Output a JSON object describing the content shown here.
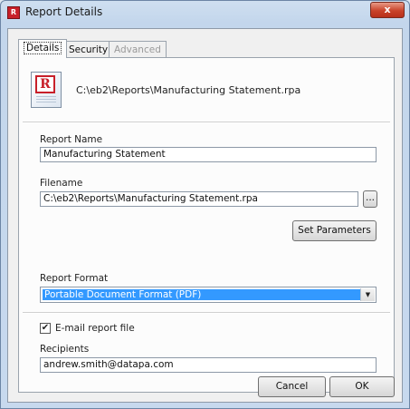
{
  "window": {
    "title": "Report Details",
    "close_glyph": "x"
  },
  "app_icon": {
    "name": "report-app-icon",
    "letter": "R"
  },
  "tabs": [
    {
      "label": "Details",
      "active": true,
      "enabled": true
    },
    {
      "label": "Security",
      "active": false,
      "enabled": true
    },
    {
      "label": "Advanced",
      "active": false,
      "enabled": false
    }
  ],
  "header": {
    "icon": "report-document-icon",
    "icon_letter": "R",
    "path": "C:\\eb2\\Reports\\Manufacturing Statement.rpa"
  },
  "fields": {
    "report_name": {
      "label": "Report Name",
      "value": "Manufacturing Statement"
    },
    "filename": {
      "label": "Filename",
      "value": "C:\\eb2\\Reports\\Manufacturing Statement.rpa",
      "browse_label": "..."
    },
    "set_parameters_label": "Set Parameters",
    "report_format": {
      "label": "Report Format",
      "value": "Portable Document Format (PDF)"
    },
    "email": {
      "checkbox_label": "E-mail report file",
      "checked": true,
      "check_glyph": "✔"
    },
    "recipients": {
      "label": "Recipients",
      "value": "andrew.smith@datapa.com"
    }
  },
  "buttons": {
    "cancel": "Cancel",
    "ok": "OK"
  },
  "colors": {
    "selection": "#3399ff",
    "close": "#c9432a",
    "brand_red": "#c8202a"
  }
}
